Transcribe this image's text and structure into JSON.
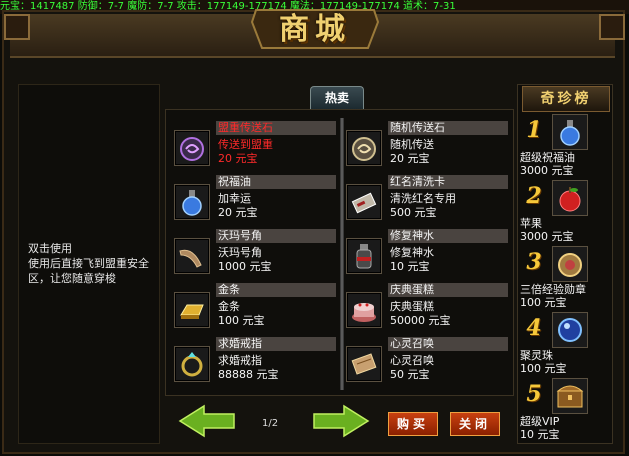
{
  "status_bar": "元宝：1417487  防御：7-7  魔防：7-7  攻击：177149-177174  魔法：177149-177174  道术：7-31",
  "title": "商城",
  "tab_label": "热卖",
  "description": {
    "line1": "双击使用",
    "line2": "使用后直接飞到盟重安全区，让您随意穿梭"
  },
  "items": [
    {
      "name": "盟重传送石",
      "desc": "传送到盟重",
      "price": "20 元宝",
      "icon": "purple-swirl-stone-icon",
      "highlight": true
    },
    {
      "name": "随机传送石",
      "desc": "随机传送",
      "price": "20 元宝",
      "icon": "swirl-stone-icon",
      "highlight": false
    },
    {
      "name": "祝福油",
      "desc": "加幸运",
      "price": "20 元宝",
      "icon": "blue-potion-icon",
      "highlight": false
    },
    {
      "name": "红名清洗卡",
      "desc": "清洗红名专用",
      "price": "500 元宝",
      "icon": "card-icon",
      "highlight": false
    },
    {
      "name": "沃玛号角",
      "desc": "沃玛号角",
      "price": "1000 元宝",
      "icon": "horn-icon",
      "highlight": false
    },
    {
      "name": "修复神水",
      "desc": "修复神水",
      "price": "10 元宝",
      "icon": "potion-bottle-icon",
      "highlight": false
    },
    {
      "name": "金条",
      "desc": "金条",
      "price": "100 元宝",
      "icon": "gold-bar-icon",
      "highlight": false
    },
    {
      "name": "庆典蛋糕",
      "desc": "庆典蛋糕",
      "price": "50000 元宝",
      "icon": "cake-icon",
      "highlight": false
    },
    {
      "name": "求婚戒指",
      "desc": "求婚戒指",
      "price": "88888 元宝",
      "icon": "ring-icon",
      "highlight": false
    },
    {
      "name": "心灵召唤",
      "desc": "心灵召唤",
      "price": "50 元宝",
      "icon": "scroll-icon",
      "highlight": false
    }
  ],
  "pagination": {
    "indicator": "1/2"
  },
  "buttons": {
    "buy": "购买",
    "close": "关闭"
  },
  "rare": {
    "title": "奇珍榜",
    "items": [
      {
        "rank": "1",
        "name": "超级祝福油",
        "price": "3000 元宝",
        "icon": "blue-potion-icon"
      },
      {
        "rank": "2",
        "name": "苹果",
        "price": "3000 元宝",
        "icon": "apple-icon"
      },
      {
        "rank": "3",
        "name": "三倍经验勋章",
        "price": "100 元宝",
        "icon": "medal-icon"
      },
      {
        "rank": "4",
        "name": "聚灵珠",
        "price": "100 元宝",
        "icon": "orb-icon"
      },
      {
        "rank": "5",
        "name": "超级VIP",
        "price": "10 元宝",
        "icon": "chest-icon"
      }
    ]
  },
  "colors": {
    "highlight_text": "#ff2a2a",
    "rank_gold": "#f6c83a",
    "status_green": "#39ff39"
  }
}
